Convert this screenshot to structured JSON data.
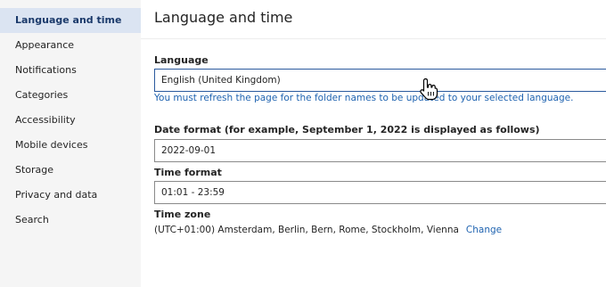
{
  "sidebar": {
    "items": [
      {
        "label": "Language and time",
        "active": true
      },
      {
        "label": "Appearance"
      },
      {
        "label": "Notifications"
      },
      {
        "label": "Categories"
      },
      {
        "label": "Accessibility"
      },
      {
        "label": "Mobile devices"
      },
      {
        "label": "Storage"
      },
      {
        "label": "Privacy and data"
      },
      {
        "label": "Search"
      }
    ]
  },
  "main": {
    "title": "Language and time",
    "language": {
      "label": "Language",
      "value": "English (United Kingdom)",
      "hint": "You must refresh the page for the folder names to be updated to your selected language."
    },
    "date_format": {
      "label": "Date format (for example, September 1, 2022 is displayed as follows)",
      "value": "2022-09-01"
    },
    "time_format": {
      "label": "Time format",
      "value": "01:01 - 23:59"
    },
    "time_zone": {
      "label": "Time zone",
      "value": "(UTC+01:00) Amsterdam, Berlin, Bern, Rome, Stockholm, Vienna",
      "change_label": "Change"
    }
  },
  "colors": {
    "accent": "#1f63b0",
    "sidebar_bg": "#f5f5f5",
    "active_item_bg": "#dbe4f2"
  }
}
